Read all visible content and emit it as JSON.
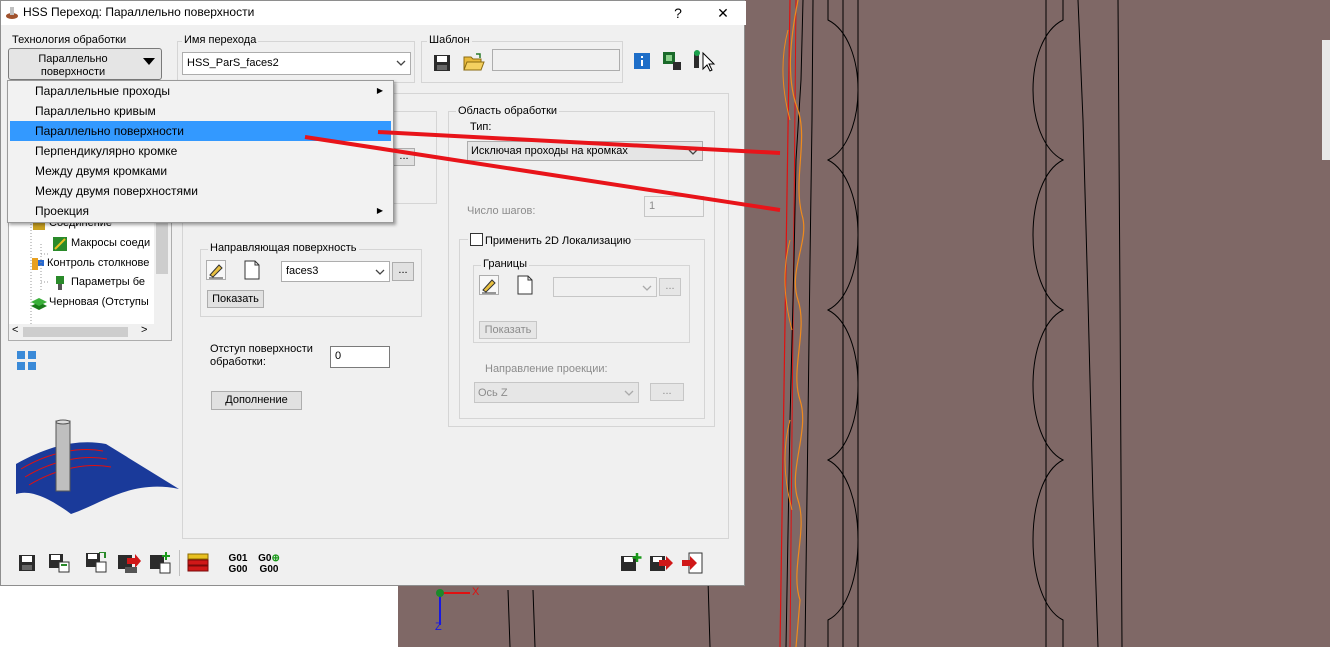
{
  "window": {
    "title": "HSS Переход: Параллельно поверхности",
    "help_label": "?",
    "close_label": "✕"
  },
  "technology": {
    "label": "Технология обработки",
    "selected": "Параллельно поверхности",
    "selected_line1": "Параллельно",
    "selected_line2": "поверхности"
  },
  "step_name": {
    "label": "Имя перехода",
    "value": "HSS_ParS_faces2"
  },
  "template": {
    "label": "Шаблон",
    "value": ""
  },
  "menu": {
    "items": [
      {
        "label": "Параллельные проходы",
        "submenu": true
      },
      {
        "label": "Параллельно кривым",
        "submenu": false
      },
      {
        "label": "Параллельно поверхности",
        "submenu": false,
        "selected": true
      },
      {
        "label": "Перпендикулярно кромке",
        "submenu": false
      },
      {
        "label": "Между двумя кромками",
        "submenu": false
      },
      {
        "label": "Между двумя поверхностями",
        "submenu": false
      },
      {
        "label": "Проекция",
        "submenu": true
      }
    ]
  },
  "tree": {
    "items": [
      {
        "label": "Соединение"
      },
      {
        "label": "Макросы соеди"
      },
      {
        "label": "Контроль столкнове"
      },
      {
        "label": "Параметры бе"
      },
      {
        "label": "Черновая (Отступы"
      }
    ]
  },
  "guide_surface": {
    "label": "Направляющая поверхность",
    "value": "faces3",
    "browse_label": "...",
    "show_label": "Показать"
  },
  "offset": {
    "label_line1": "Отступ поверхности",
    "label_line2": "обработки:",
    "value": "0"
  },
  "addition_button": "Дополнение",
  "machining_area": {
    "label": "Область обработки",
    "type_label": "Тип:",
    "type_value": "Исключая проходы на кромках",
    "steps_label": "Число шагов:",
    "steps_value": "1",
    "localization_label": "Применить 2D Локализацию",
    "localization_checked": false,
    "bounds_label": "Границы",
    "bounds_browse": "...",
    "bounds_show": "Показать",
    "projection_label": "Направление проекции:",
    "projection_value": "Ось Z",
    "projection_browse": "..."
  },
  "bottom_toolbar": {
    "g01_line1": "G01",
    "g01_line2": "G00",
    "g0_line1": "G0",
    "g0_line2": "G00"
  },
  "viewport": {
    "axis_x": "X",
    "axis_z": "Z"
  },
  "colors": {
    "viewport_bg": "#7f6866",
    "selection": "#3399ff",
    "annotation": "#e8141a"
  }
}
